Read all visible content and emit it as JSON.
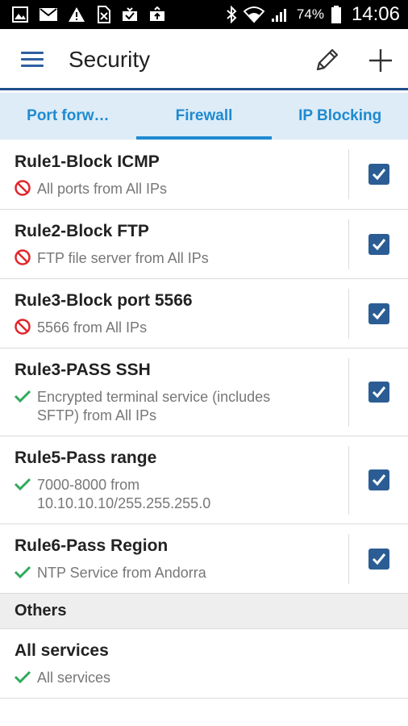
{
  "status_bar": {
    "battery_percent": "74%",
    "time": "14:06"
  },
  "app_bar": {
    "title": "Security",
    "menu_icon": "hamburger-menu-icon",
    "edit_icon": "pencil-icon",
    "add_icon": "plus-icon"
  },
  "tabs": [
    {
      "label": "Port forw…",
      "active": false
    },
    {
      "label": "Firewall",
      "active": true
    },
    {
      "label": "IP Blocking",
      "active": false
    }
  ],
  "rules": [
    {
      "title": "Rule1-Block ICMP",
      "desc": "All ports from All IPs",
      "type": "block",
      "checked": true
    },
    {
      "title": "Rule2-Block FTP",
      "desc": "FTP file server from All IPs",
      "type": "block",
      "checked": true
    },
    {
      "title": "Rule3-Block port 5566",
      "desc": "5566 from All IPs",
      "type": "block",
      "checked": true
    },
    {
      "title": "Rule3-PASS SSH",
      "desc_line1": "Encrypted terminal service (includes",
      "desc_line2": "SFTP) from All IPs",
      "type": "pass",
      "checked": true
    },
    {
      "title": "Rule5-Pass range",
      "desc_line1": "7000-8000 from",
      "desc_line2": "10.10.10.10/255.255.255.0",
      "type": "pass",
      "checked": true
    },
    {
      "title": "Rule6-Pass Region",
      "desc": "NTP Service from Andorra",
      "type": "pass",
      "checked": true
    }
  ],
  "others": {
    "header": "Others",
    "items": [
      {
        "title": "All services",
        "desc": "All services",
        "type": "pass"
      }
    ]
  },
  "colors": {
    "accent": "#1f8ad0",
    "checkbox": "#2b5d94",
    "block": "#e0262b",
    "pass": "#2eaa5c",
    "tab_bg": "#ddecf7"
  }
}
